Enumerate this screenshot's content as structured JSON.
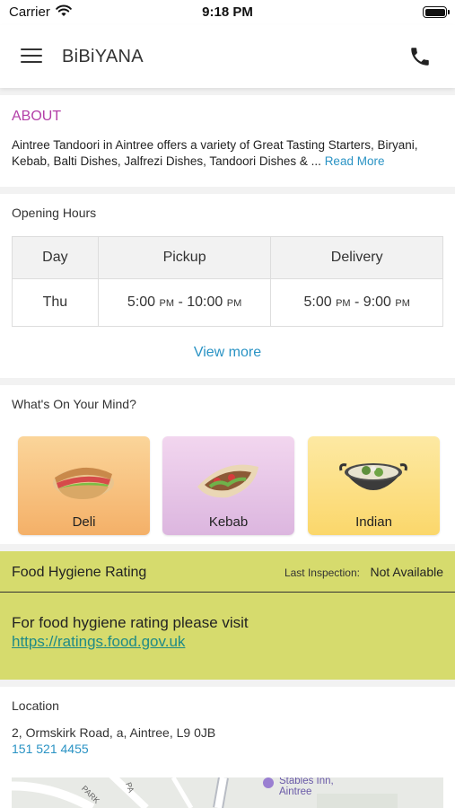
{
  "status_bar": {
    "carrier": "Carrier",
    "time": "9:18 PM"
  },
  "header": {
    "title": "BiBiYANA"
  },
  "about": {
    "heading": "ABOUT",
    "description": "Aintree Tandoori in Aintree offers a variety of Great Tasting Starters, Biryani, Kebab, Balti Dishes, Jalfrezi Dishes, Tandoori Dishes & ...",
    "read_more": "Read More"
  },
  "hours": {
    "label": "Opening Hours",
    "columns": [
      "Day",
      "Pickup",
      "Delivery"
    ],
    "row": {
      "day": "Thu",
      "pickup_open": "5:00",
      "pickup_open_suffix": "PM",
      "pickup_close": "10:00",
      "pickup_close_suffix": "PM",
      "delivery_open": "5:00",
      "delivery_open_suffix": "PM",
      "delivery_close": "9:00",
      "delivery_close_suffix": "PM"
    },
    "view_more": "View more"
  },
  "mind": {
    "label": "What's On Your Mind?",
    "tiles": [
      {
        "label": "Deli",
        "icon": "sandwich-icon"
      },
      {
        "label": "Kebab",
        "icon": "kebab-wrap-icon"
      },
      {
        "label": "Indian",
        "icon": "curry-bowl-icon"
      }
    ]
  },
  "hygiene": {
    "title": "Food Hygiene Rating",
    "inspection_label": "Last Inspection:",
    "inspection_value": "Not Available",
    "text": "For food hygiene rating please visit",
    "link": "https://ratings.food.gov.uk"
  },
  "location": {
    "label": "Location",
    "address": "2, Ormskirk Road, a, Aintree, L9 0JB",
    "phone": "151 521 4455",
    "map": {
      "poi_name_line1": "Stables Inn,",
      "poi_name_line2": "Aintree",
      "street_1": "PARK",
      "street_2": "PA"
    }
  },
  "colors": {
    "accent_link": "#2a93c4",
    "about_heading": "#b33fa8",
    "hygiene_background": "#d6db6d",
    "hygiene_link": "#1f8a86"
  }
}
